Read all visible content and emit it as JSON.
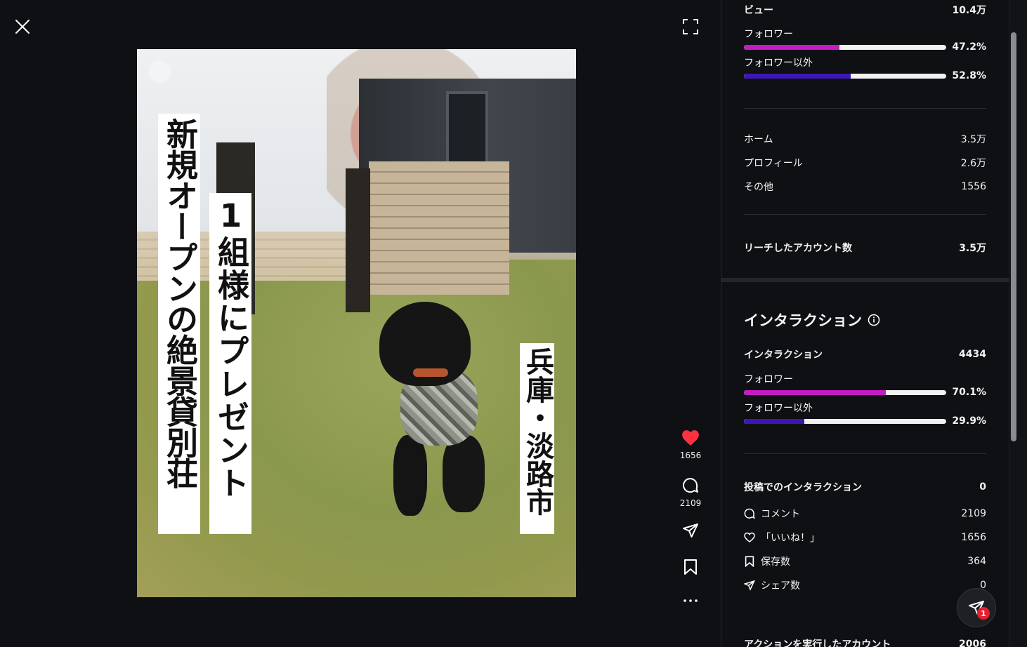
{
  "post": {
    "banner_1": "新規オープンの絶景貸別荘",
    "banner_2": "1組様にプレゼント",
    "banner_3": "兵庫・淡路市"
  },
  "actions": {
    "likes": "1656",
    "comments": "2109"
  },
  "views": {
    "label": "ビュー",
    "value": "10.4万",
    "follower_label": "フォロワー",
    "follower_pct": "47.2%",
    "follower_fraction": 0.472,
    "nonfollower_label": "フォロワー以外",
    "nonfollower_pct": "52.8%",
    "nonfollower_fraction": 0.528
  },
  "sources": [
    {
      "label": "ホーム",
      "value": "3.5万"
    },
    {
      "label": "プロフィール",
      "value": "2.6万"
    },
    {
      "label": "その他",
      "value": "1556"
    }
  ],
  "reach": {
    "label": "リーチしたアカウント数",
    "value": "3.5万"
  },
  "interactions": {
    "section_title": "インタラクション",
    "label": "インタラクション",
    "value": "4434",
    "follower_label": "フォロワー",
    "follower_pct": "70.1%",
    "follower_fraction": 0.701,
    "nonfollower_label": "フォロワー以外",
    "nonfollower_pct": "29.9%",
    "nonfollower_fraction": 0.299
  },
  "post_interactions": {
    "label": "投稿でのインタラクション",
    "value": "0",
    "items": [
      {
        "icon": "comment-icon",
        "label": "コメント",
        "value": "2109"
      },
      {
        "icon": "heart-icon",
        "label": "「いいね！」",
        "value": "1656"
      },
      {
        "icon": "bookmark-icon",
        "label": "保存数",
        "value": "364"
      },
      {
        "icon": "share-icon",
        "label": "シェア数",
        "value": "0"
      }
    ]
  },
  "accounts_action": {
    "label": "アクションを実行したアカウント",
    "value": "2006"
  },
  "fab": {
    "badge": "1"
  },
  "colors": {
    "follower_fill": "#c51bc4",
    "nonfollower_fill": "#3d16b8",
    "like_red": "#ff3040",
    "background": "#0f1014"
  }
}
